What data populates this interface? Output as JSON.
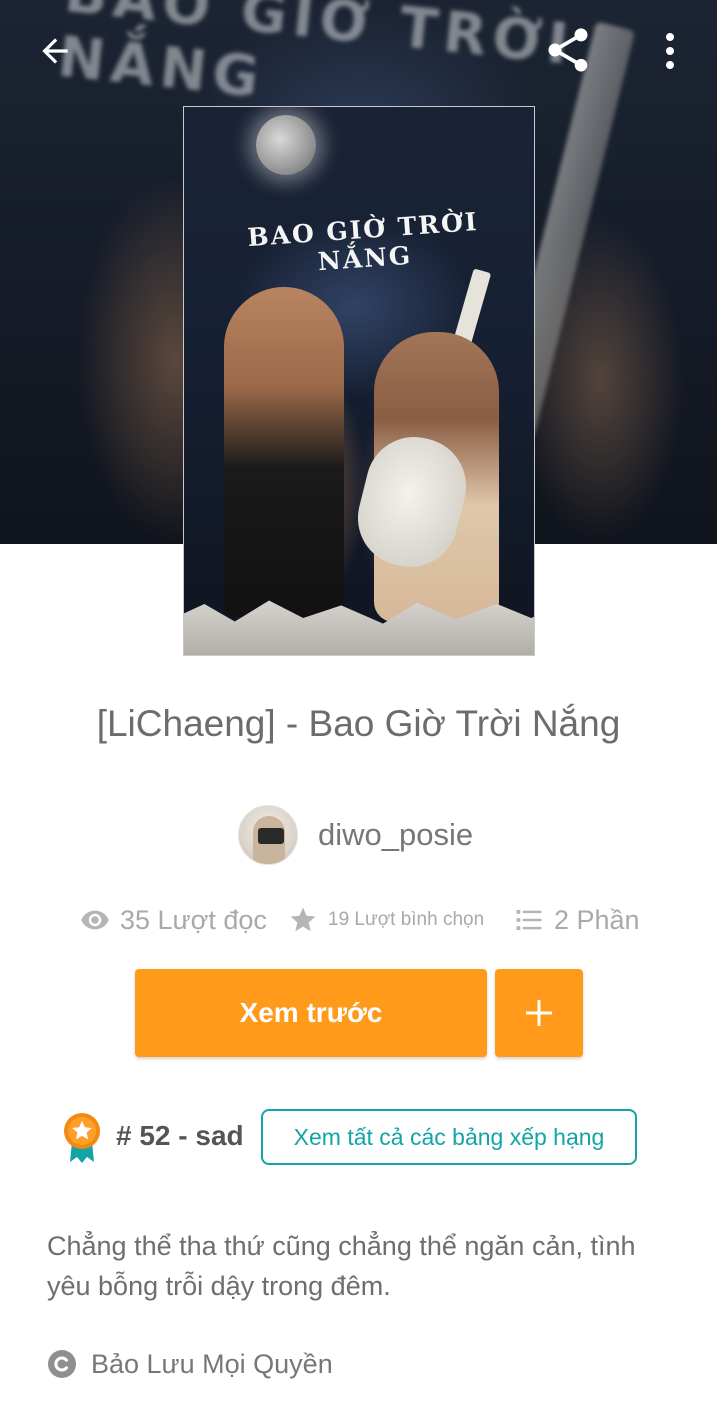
{
  "colors": {
    "accent": "#ff9a1a",
    "teal": "#13a5a5",
    "stat_gray": "#a9a9a9",
    "text_gray": "#6c6c6c"
  },
  "topbar": {
    "back_icon": "arrow-left-icon",
    "share_icon": "share-icon",
    "more_icon": "more-vertical-icon"
  },
  "cover": {
    "title_text": "BAO GIỜ TRỜI NẮNG"
  },
  "story": {
    "title": "[LiChaeng] - Bao Giờ Trời Nắng",
    "author": "diwo_posie"
  },
  "stats": {
    "reads": "35 Lượt đọc",
    "votes": "19 Lượt bình chọn",
    "parts": "2 Phần",
    "reads_icon": "eye-icon",
    "votes_icon": "star-icon",
    "parts_icon": "list-icon"
  },
  "actions": {
    "preview_label": "Xem trước",
    "add_icon": "plus-icon"
  },
  "ranking": {
    "badge_icon": "ribbon-star-icon",
    "text": "# 52 - sad",
    "link_label": "Xem tất cả các bảng xếp hạng"
  },
  "description": "Chẳng thể tha thứ cũng chẳng thể ngăn cản, tình yêu bỗng trỗi dậy trong đêm.",
  "copyright": {
    "icon": "copyright-icon",
    "label": "Bảo Lưu Mọi Quyền"
  }
}
